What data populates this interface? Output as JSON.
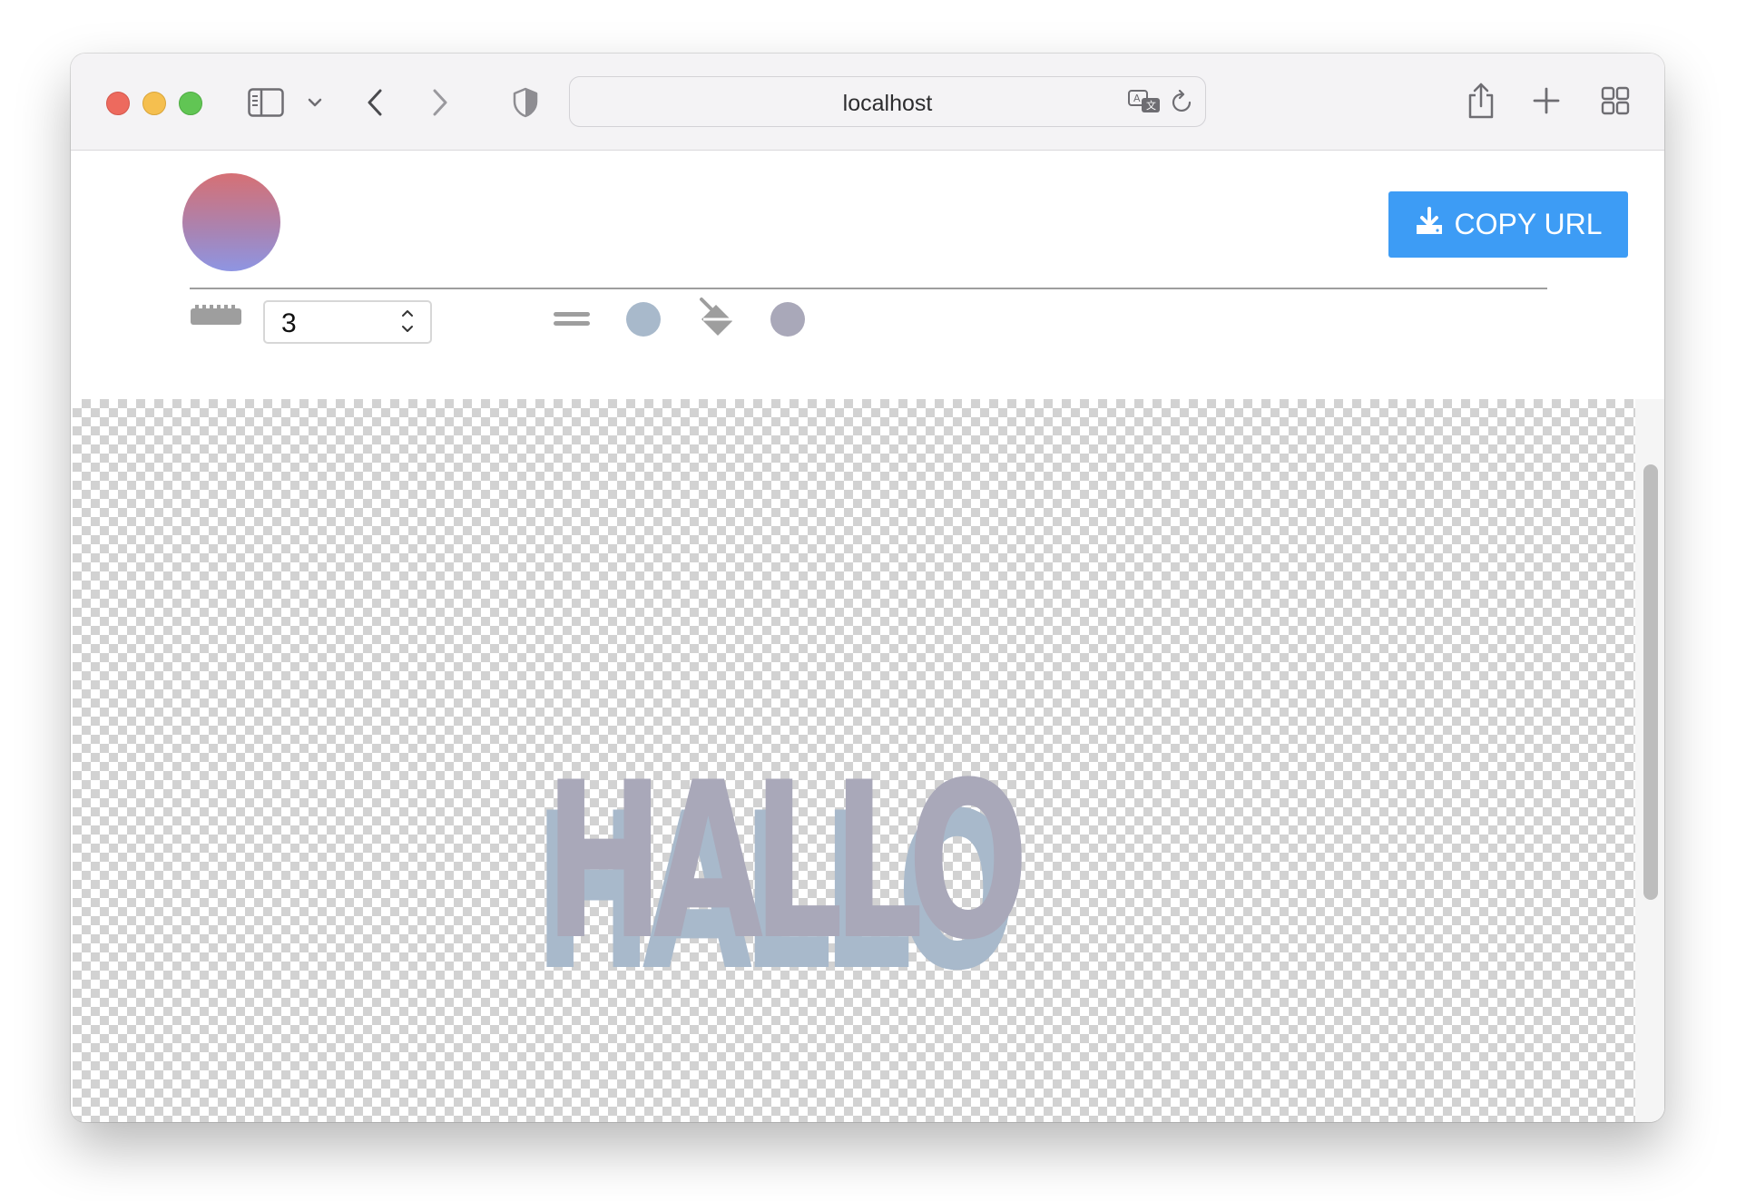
{
  "browser": {
    "url": "localhost",
    "icons": {
      "sidebar": "sidebar-icon",
      "chevron": "chevron-down-icon",
      "back": "back-arrow-icon",
      "forward": "forward-arrow-icon",
      "shield": "shield-icon",
      "translate": "translate-icon",
      "reload": "reload-icon",
      "share": "share-icon",
      "new_tab": "plus-icon",
      "tabs_overview": "tab-grid-icon"
    }
  },
  "app": {
    "copy_button_label": "COPY URL",
    "stroke_width_value": "3",
    "canvas_text": "HALLO",
    "colors": {
      "primary_button": "#3d9cf5",
      "text_fill": "#a9a8b9",
      "shadow_fill": "#a8b9cb",
      "color_swatch_1": "#a8b9cb",
      "color_swatch_2": "#a9a8b9",
      "logo_gradient_top": "#d67074",
      "logo_gradient_bottom": "#8e95e3"
    },
    "tool_icons": [
      "ruler-icon",
      "line-style-icon",
      "color-swatch-icon",
      "fill-bucket-icon",
      "color-swatch-icon"
    ]
  }
}
